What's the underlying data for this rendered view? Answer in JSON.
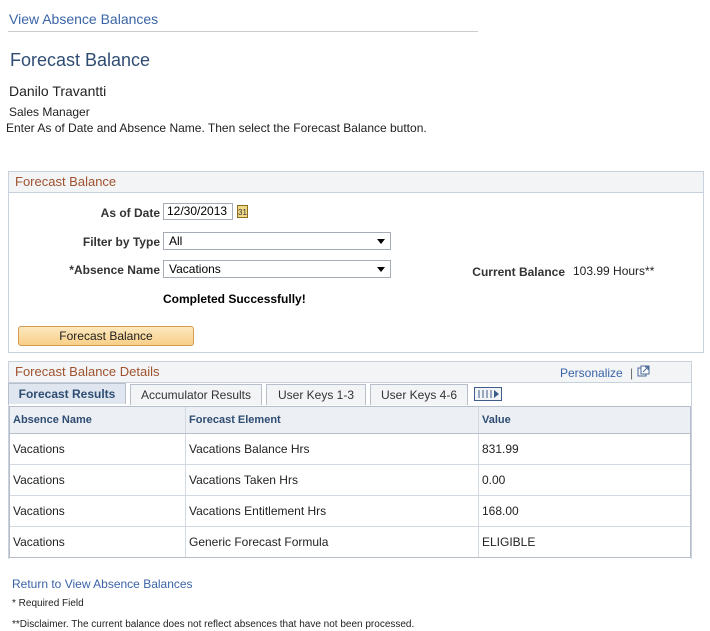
{
  "breadcrumb": "View Absence Balances",
  "page_title": "Forecast Balance",
  "employee": {
    "name": "Danilo Travantti",
    "job_title": "Sales Manager"
  },
  "instructions": "Enter As of Date and Absence Name. Then select the Forecast Balance button.",
  "forecast_group": {
    "header": "Forecast Balance",
    "as_of_date_label": "As of Date",
    "as_of_date_value": "12/30/2013",
    "filter_label": "Filter by Type",
    "filter_value": "All",
    "absence_label": "*Absence Name",
    "absence_value": "Vacations",
    "current_balance_label": "Current Balance",
    "current_balance_value": "103.99 Hours**",
    "status_message": "Completed Successfully!",
    "button_label": "Forecast Balance"
  },
  "details_group": {
    "header": "Forecast Balance Details",
    "personalize_label": "Personalize",
    "tabs": [
      {
        "label": "Forecast Results"
      },
      {
        "label": "Accumulator Results"
      },
      {
        "label": "User Keys 1-3"
      },
      {
        "label": "User Keys 4-6"
      }
    ],
    "columns": [
      "Absence Name",
      "Forecast Element",
      "Value"
    ],
    "rows": [
      [
        "Vacations",
        "Vacations Balance Hrs",
        "831.99"
      ],
      [
        "Vacations",
        "Vacations Taken Hrs",
        "0.00"
      ],
      [
        "Vacations",
        "Vacations Entitlement Hrs",
        "168.00"
      ],
      [
        "Vacations",
        "Generic Forecast Formula",
        "ELIGIBLE"
      ]
    ]
  },
  "return_link": "Return to View Absence Balances",
  "required_note": "* Required Field",
  "disclaimer": "**Disclaimer. The current balance does not reflect absences that have not been processed.",
  "colors": {
    "link": "#3a64a7",
    "header_text": "#a0522d",
    "button_bg": "#f8cf88"
  },
  "icons": [
    "calendar-icon",
    "dropdown-arrow-icon",
    "new-window-icon",
    "show-all-columns-icon"
  ]
}
